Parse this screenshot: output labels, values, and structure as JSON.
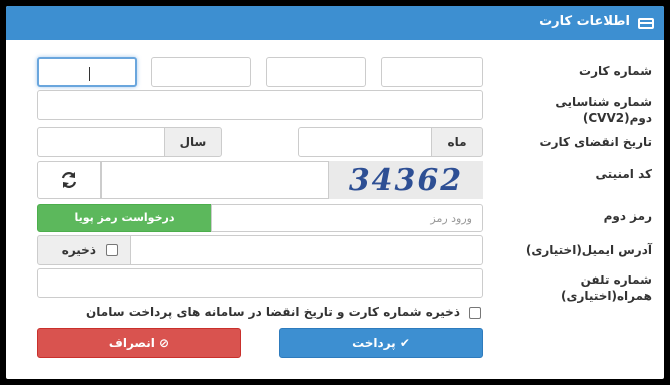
{
  "header": {
    "title": "اطلاعات کارت",
    "icon": "credit-card-icon"
  },
  "fields": {
    "card_number": {
      "label": "شماره کارت"
    },
    "cvv2": {
      "label_line1": "شماره شناسایی",
      "label_line2": "دوم(CVV2)"
    },
    "expiry": {
      "label": "تاریخ انقضای کارت",
      "month_addon": "ماه",
      "year_addon": "سال"
    },
    "captcha": {
      "label": "کد امنیتی",
      "image_text": "34362",
      "refresh_icon": "refresh-icon"
    },
    "second_password": {
      "label": "رمز دوم",
      "placeholder": "ورود رمز",
      "request_button": "درخواست رمز پویا"
    },
    "email": {
      "label": "آدرس ایمیل(اختیاری)",
      "save_label": "ذخیره"
    },
    "phone": {
      "label_line1": "شماره تلفن",
      "label_line2": "همراه(اختیاری)"
    }
  },
  "save_card_text": "ذخیره شماره کارت و تاریخ انقضا در سامانه های پرداخت سامان",
  "buttons": {
    "pay": "پرداخت",
    "cancel": "انصراف"
  },
  "colors": {
    "header": "#3d8fd1",
    "pay": "#3d8fd1",
    "cancel": "#d9534f",
    "request": "#5cb85c"
  }
}
